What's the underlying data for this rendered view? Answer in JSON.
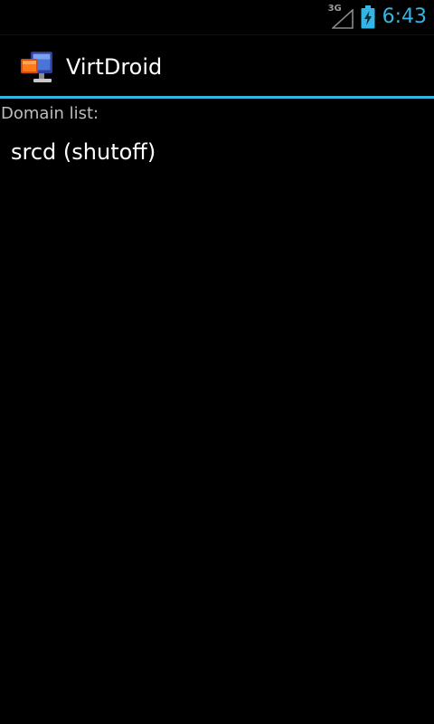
{
  "status_bar": {
    "network_type": "3G",
    "clock": "6:43",
    "signal_icon": "signal-strength-empty-icon",
    "battery_icon": "battery-charging-icon",
    "accent_color": "#33b5e5"
  },
  "action_bar": {
    "title": "VirtDroid",
    "app_icon": "virtdroid-app-icon",
    "divider_color": "#33b5e5"
  },
  "content": {
    "section_label": "Domain list:",
    "domains": [
      {
        "label": "srcd (shutoff)"
      }
    ]
  }
}
